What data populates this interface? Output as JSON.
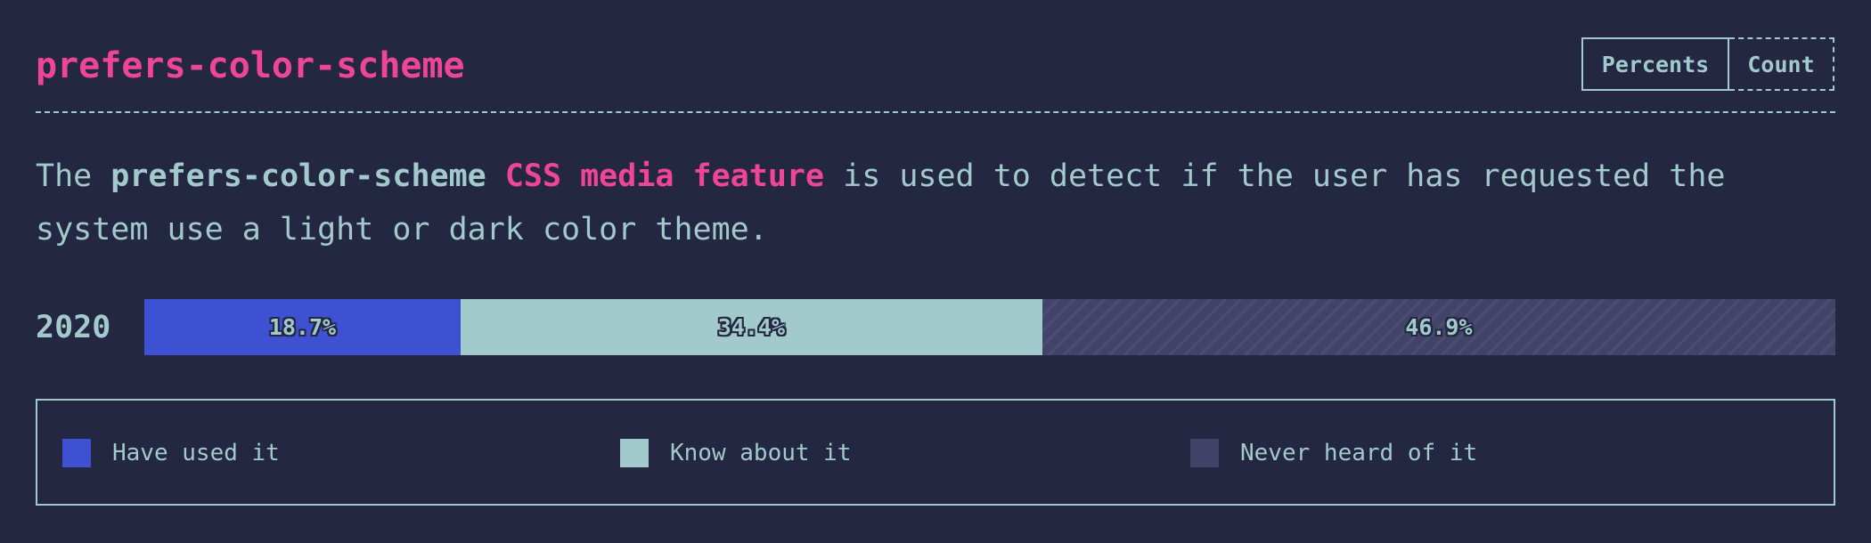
{
  "header": {
    "title": "prefers-color-scheme",
    "toggle": [
      {
        "label": "Percents",
        "active": true
      },
      {
        "label": "Count",
        "active": false
      }
    ]
  },
  "description": {
    "part1": "The ",
    "keyword": "prefers-color-scheme",
    "part2": " ",
    "link": "CSS media feature",
    "part3": " is used to detect if the user has requested the system use a light or dark color theme."
  },
  "chart_data": {
    "type": "bar",
    "orientation": "horizontal",
    "stacked": true,
    "categories": [
      "2020"
    ],
    "series": [
      {
        "name": "Have used it",
        "values": [
          18.7
        ],
        "label": "18.7%",
        "color": "#3f51d3"
      },
      {
        "name": "Know about it",
        "values": [
          34.4
        ],
        "label": "34.4%",
        "color": "#a2c9cb"
      },
      {
        "name": "Never heard of it",
        "values": [
          46.9
        ],
        "label": "46.9%",
        "color": "#414468"
      }
    ]
  }
}
